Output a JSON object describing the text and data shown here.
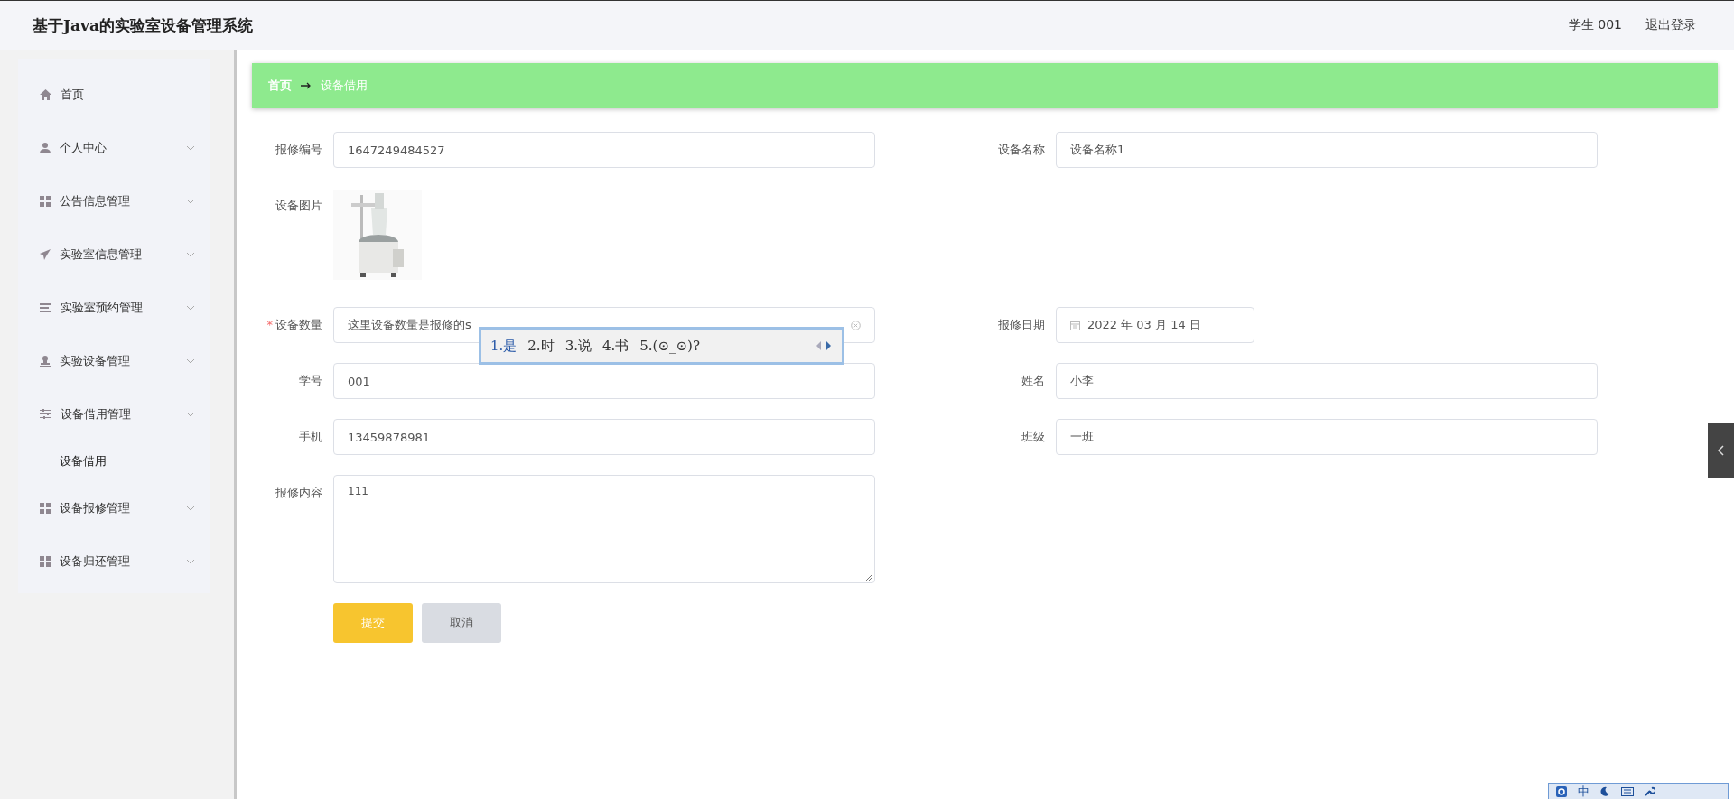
{
  "header": {
    "title": "基于Java的实验室设备管理系统",
    "user_role": "学生",
    "user_id": "001",
    "logout": "退出登录"
  },
  "sidebar": {
    "items": [
      {
        "label": "首页",
        "submenu": false
      },
      {
        "label": "个人中心",
        "submenu": true
      },
      {
        "label": "公告信息管理",
        "submenu": true
      },
      {
        "label": "实验室信息管理",
        "submenu": true
      },
      {
        "label": "实验室预约管理",
        "submenu": true
      },
      {
        "label": "实验设备管理",
        "submenu": true
      },
      {
        "label": "设备借用管理",
        "submenu": true,
        "children": [
          {
            "label": "设备借用"
          }
        ]
      },
      {
        "label": "设备报修管理",
        "submenu": true
      },
      {
        "label": "设备归还管理",
        "submenu": true
      }
    ]
  },
  "breadcrumb": {
    "home": "首页",
    "current": "设备借用"
  },
  "form": {
    "rows": [
      [
        {
          "kind": "text",
          "label": "报修编号",
          "value": "1647249484527",
          "clearable": false
        },
        {
          "kind": "text",
          "label": "设备名称",
          "value": "设备名称1",
          "clearable": false
        }
      ],
      [
        {
          "label": "设备图片"
        }
      ],
      [
        {
          "kind": "text",
          "label": "设备数量",
          "value": "这里设备数量是报修的s",
          "required_mark": "*",
          "clearable": true
        },
        {
          "kind": "date",
          "label": "报修日期",
          "value": "2022 年 03 月 14 日"
        }
      ],
      [
        {
          "kind": "text",
          "label": "学号",
          "value": "001",
          "clearable": false
        },
        {
          "kind": "text",
          "label": "姓名",
          "value": "小李",
          "clearable": false
        }
      ],
      [
        {
          "kind": "text",
          "label": "手机",
          "value": "13459878981",
          "clearable": false
        },
        {
          "kind": "text",
          "label": "班级",
          "value": "一班",
          "clearable": false
        }
      ],
      [
        {
          "kind": "textarea",
          "label": "报修内容",
          "value": "111"
        }
      ]
    ],
    "buttons": [
      {
        "label": "提交",
        "kind": "primary"
      },
      {
        "label": "取消",
        "kind": "secondary"
      }
    ]
  },
  "ime_popup": {
    "candidates": [
      {
        "text": "1.是",
        "selected": true
      },
      {
        "text": "2.时",
        "selected": false
      },
      {
        "text": "3.说",
        "selected": false
      },
      {
        "text": "4.书",
        "selected": false
      },
      {
        "text": "5.(⊙_⊙)?",
        "selected": false
      }
    ]
  },
  "ime_bar": {
    "mode": "中"
  }
}
